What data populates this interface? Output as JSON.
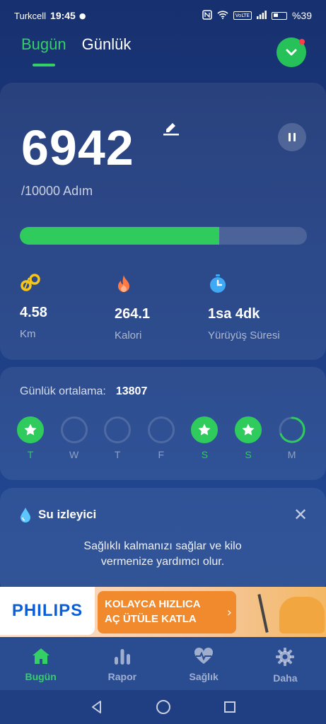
{
  "status_bar": {
    "carrier": "Turkcell",
    "time": "19:45",
    "volte": "VoLTE",
    "battery_percent": "%39"
  },
  "tabs": [
    {
      "label": "Bugün",
      "active": true
    },
    {
      "label": "Günlük",
      "active": false
    }
  ],
  "steps_card": {
    "steps": "6942",
    "goal_text": "/10000 Adım",
    "progress_fraction": 0.694,
    "stats": [
      {
        "icon": "route-icon",
        "value": "4.58",
        "label": "Km",
        "color": "#f5c518"
      },
      {
        "icon": "flame-icon",
        "value": "264.1",
        "label": "Kalori",
        "color": "#ff7a45"
      },
      {
        "icon": "stopwatch-icon",
        "value": "1sa 4dk",
        "label": "Yürüyüş Süresi",
        "color": "#3fa9f5"
      }
    ]
  },
  "weekly_card": {
    "avg_label": "Günlük ortalama:",
    "avg_value": "13807",
    "days": [
      {
        "letter": "T",
        "state": "done"
      },
      {
        "letter": "W",
        "state": "empty"
      },
      {
        "letter": "T",
        "state": "empty"
      },
      {
        "letter": "F",
        "state": "empty"
      },
      {
        "letter": "S",
        "state": "done"
      },
      {
        "letter": "S",
        "state": "done"
      },
      {
        "letter": "M",
        "state": "partial",
        "fraction": 0.69
      }
    ]
  },
  "water_card": {
    "title": "Su izleyici",
    "description": "Sağlıklı kalmanızı sağlar ve kilo vermenize yardımcı olur."
  },
  "ad": {
    "brand": "PHILIPS",
    "line1": "KOLAYCA HIZLICA",
    "line2": "AÇ ÜTÜLE KATLA"
  },
  "bottom_nav": [
    {
      "label": "Bugün",
      "icon": "home-icon",
      "active": true
    },
    {
      "label": "Rapor",
      "icon": "bar-chart-icon",
      "active": false
    },
    {
      "label": "Sağlık",
      "icon": "heart-pulse-icon",
      "active": false
    },
    {
      "label": "Daha",
      "icon": "gear-icon",
      "active": false
    }
  ],
  "colors": {
    "accent": "#35d065",
    "background": "#1d3c80"
  }
}
